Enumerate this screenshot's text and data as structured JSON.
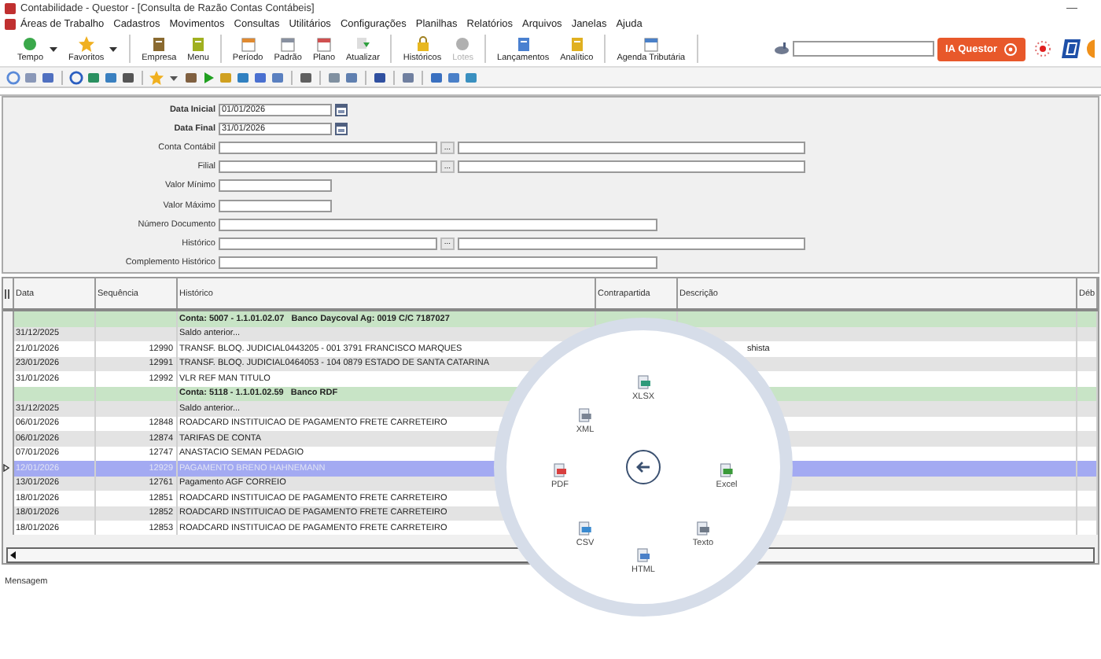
{
  "window": {
    "title": "Contabilidade - Questor - [Consulta de Razão Contas Contábeis]",
    "minimize": "—"
  },
  "menu": [
    "Áreas de Trabalho",
    "Cadastros",
    "Movimentos",
    "Consultas",
    "Utilitários",
    "Configurações",
    "Planilhas",
    "Relatórios",
    "Arquivos",
    "Janelas",
    "Ajuda"
  ],
  "toolbar": {
    "groups": [
      [
        {
          "label": "Tempo",
          "dropdown": true,
          "disabled": false
        },
        {
          "label": "Favoritos",
          "dropdown": true,
          "disabled": false
        }
      ],
      [
        {
          "label": "Empresa",
          "dropdown": false,
          "disabled": false
        },
        {
          "label": "Menu",
          "dropdown": false,
          "disabled": false
        }
      ],
      [
        {
          "label": "Período",
          "dropdown": false,
          "disabled": false
        },
        {
          "label": "Padrão",
          "dropdown": false,
          "disabled": false
        },
        {
          "label": "Plano",
          "dropdown": false,
          "disabled": false
        },
        {
          "label": "Atualizar",
          "dropdown": false,
          "disabled": false
        }
      ],
      [
        {
          "label": "Históricos",
          "dropdown": false,
          "disabled": false
        },
        {
          "label": "Lotes",
          "dropdown": false,
          "disabled": true
        }
      ],
      [
        {
          "label": "Lançamentos",
          "dropdown": false,
          "disabled": false
        },
        {
          "label": "Analítico",
          "dropdown": false,
          "disabled": false
        }
      ],
      [
        {
          "label": "Agenda Tributária",
          "dropdown": false,
          "disabled": false
        }
      ]
    ],
    "ia_button": "IA Questor"
  },
  "filters": [
    {
      "label": "Data Inicial",
      "bold": true,
      "kind": "date",
      "value": "01/01/2026"
    },
    {
      "label": "Data Final",
      "bold": true,
      "kind": "date",
      "value": "31/01/2026"
    },
    {
      "label": "Conta Contábil",
      "bold": false,
      "kind": "lookup",
      "lookup_button": "..."
    },
    {
      "label": "Filial",
      "bold": false,
      "kind": "lookup",
      "lookup_button": "..."
    },
    {
      "label": "Valor Mínimo",
      "bold": false,
      "kind": "short"
    },
    {
      "label": "Valor Máximo",
      "bold": false,
      "kind": "short"
    },
    {
      "label": "Número Documento",
      "bold": false,
      "kind": "long"
    },
    {
      "label": "Histórico",
      "bold": false,
      "kind": "lookup",
      "lookup_button": "..."
    },
    {
      "label": "Complemento Histórico",
      "bold": false,
      "kind": "long"
    }
  ],
  "table": {
    "columns": [
      "Data",
      "Sequência",
      "Histórico",
      "Contrapartida",
      "Descrição",
      "Déb"
    ],
    "rows": [
      {
        "kind": "group",
        "text": "Conta: 5007 - 1.1.01.02.07   Banco Daycoval Ag: 0019 C/C 7187027",
        "selected": false
      },
      {
        "kind": "entry",
        "data": "31/12/2025",
        "historico": "Saldo anterior...",
        "selected": false
      },
      {
        "kind": "entry",
        "data": "21/01/2026",
        "sequencia": "12990",
        "historico": "TRANSF. BLOQ. JUDICIAL0443205 - 001 3791 FRANCISCO MARQUES",
        "descricao": "shista",
        "selected": false
      },
      {
        "kind": "entry",
        "data": "23/01/2026",
        "sequencia": "12991",
        "historico": "TRANSF. BLOQ. JUDICIAL0464053 - 104 0879 ESTADO DE SANTA CATARINA",
        "selected": false
      },
      {
        "kind": "entry",
        "data": "31/01/2026",
        "sequencia": "12992",
        "historico": "VLR REF MAN TITULO",
        "selected": false
      },
      {
        "kind": "group",
        "text": "Conta: 5118 - 1.1.01.02.59   Banco RDF",
        "selected": false
      },
      {
        "kind": "entry",
        "data": "31/12/2025",
        "historico": "Saldo anterior...",
        "selected": false
      },
      {
        "kind": "entry",
        "data": "06/01/2026",
        "sequencia": "12848",
        "historico": "ROADCARD INSTITUICAO DE PAGAMENTO FRETE CARRETEIRO",
        "selected": false
      },
      {
        "kind": "entry",
        "data": "06/01/2026",
        "sequencia": "12874",
        "historico": "TARIFAS DE CONTA",
        "selected": false
      },
      {
        "kind": "entry",
        "data": "07/01/2026",
        "sequencia": "12747",
        "historico": "ANASTACIO SEMAN PEDAGIO",
        "selected": false
      },
      {
        "kind": "entry",
        "data": "12/01/2026",
        "sequencia": "12929",
        "historico": "PAGAMENTO BRENO HAHNEMANN",
        "selected": true
      },
      {
        "kind": "entry",
        "data": "13/01/2026",
        "sequencia": "12761",
        "historico": "Pagamento AGF CORREIO",
        "selected": false
      },
      {
        "kind": "entry",
        "data": "18/01/2026",
        "sequencia": "12851",
        "historico": "ROADCARD INSTITUICAO DE PAGAMENTO FRETE CARRETEIRO",
        "selected": false
      },
      {
        "kind": "entry",
        "data": "18/01/2026",
        "sequencia": "12852",
        "historico": "ROADCARD INSTITUICAO DE PAGAMENTO FRETE CARRETEIRO",
        "selected": false
      },
      {
        "kind": "entry",
        "data": "18/01/2026",
        "sequencia": "12853",
        "historico": "ROADCARD INSTITUICAO DE PAGAMENTO FRETE CARRETEIRO",
        "selected": false
      }
    ]
  },
  "export_menu": {
    "items": [
      {
        "label": "XLSX",
        "color": "#2e9a7a"
      },
      {
        "label": "XML",
        "color": "#7a8494"
      },
      {
        "label": "PDF",
        "color": "#d84040"
      },
      {
        "label": "CSV",
        "color": "#3a8ad0"
      },
      {
        "label": "HTML",
        "color": "#4a80c8"
      },
      {
        "label": "Texto",
        "color": "#707a88"
      },
      {
        "label": "Excel",
        "color": "#3a9a3a"
      }
    ]
  },
  "status_bar": {
    "label": "Mensagem"
  }
}
